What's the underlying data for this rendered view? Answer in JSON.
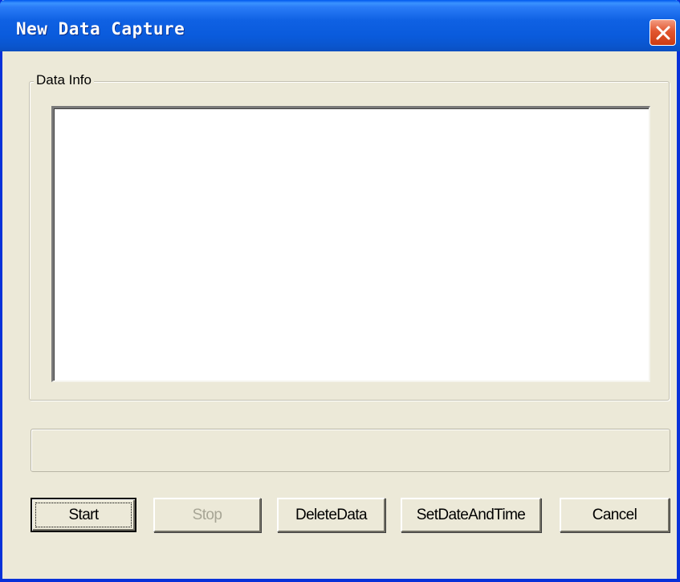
{
  "window": {
    "title": "New Data Capture"
  },
  "group": {
    "label": "Data Info"
  },
  "buttons": {
    "start": "Start",
    "stop": "Stop",
    "delete_data": "DeleteData",
    "set_date_time": "SetDateAndTime",
    "cancel": "Cancel"
  },
  "icons": {
    "close": "close-icon"
  },
  "colors": {
    "titlebar": "#0a5bdc",
    "close_button": "#e2562f",
    "dialog_bg": "#ece9d8",
    "disabled_text": "#a7a595"
  }
}
